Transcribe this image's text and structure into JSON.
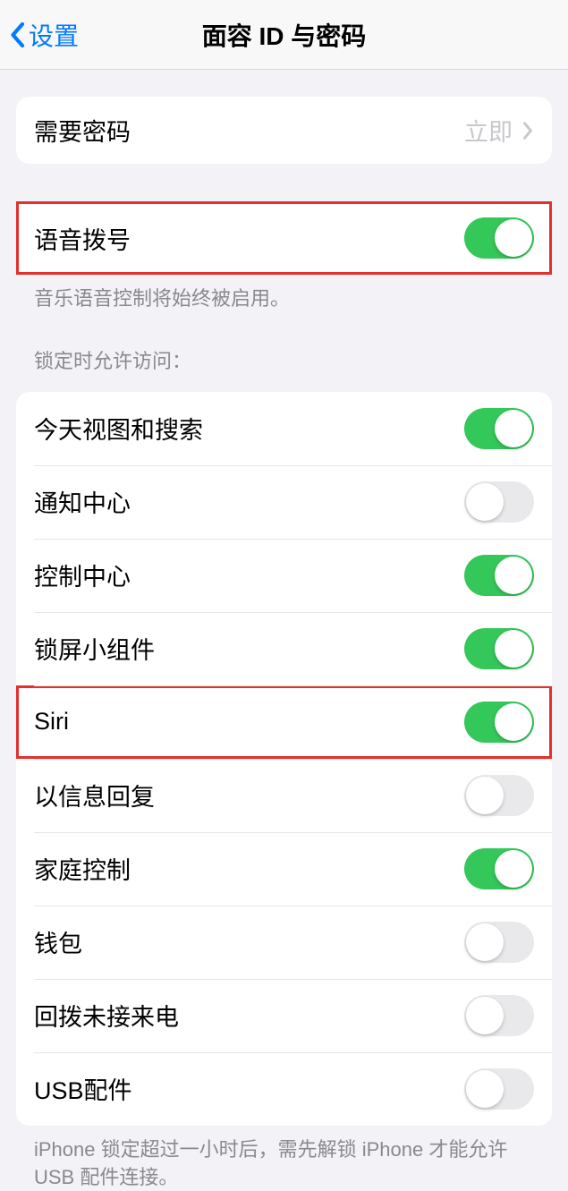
{
  "nav": {
    "back_label": "设置",
    "title": "面容 ID 与密码"
  },
  "require_passcode": {
    "label": "需要密码",
    "value": "立即"
  },
  "voice_dial": {
    "label": "语音拨号",
    "footer": "音乐语音控制将始终被启用。"
  },
  "locked_access": {
    "header": "锁定时允许访问：",
    "items": [
      {
        "label": "今天视图和搜索",
        "on": true,
        "name": "today-view-search"
      },
      {
        "label": "通知中心",
        "on": false,
        "name": "notification-center"
      },
      {
        "label": "控制中心",
        "on": true,
        "name": "control-center"
      },
      {
        "label": "锁屏小组件",
        "on": true,
        "name": "lock-screen-widgets"
      },
      {
        "label": "Siri",
        "on": true,
        "name": "siri",
        "highlight": true
      },
      {
        "label": "以信息回复",
        "on": false,
        "name": "reply-with-message"
      },
      {
        "label": "家庭控制",
        "on": true,
        "name": "home-control"
      },
      {
        "label": "钱包",
        "on": false,
        "name": "wallet"
      },
      {
        "label": "回拨未接来电",
        "on": false,
        "name": "return-missed-calls"
      },
      {
        "label": "USB配件",
        "on": false,
        "name": "usb-accessories"
      }
    ],
    "footer": "iPhone 锁定超过一小时后，需先解锁 iPhone 才能允许 USB 配件连接。"
  }
}
